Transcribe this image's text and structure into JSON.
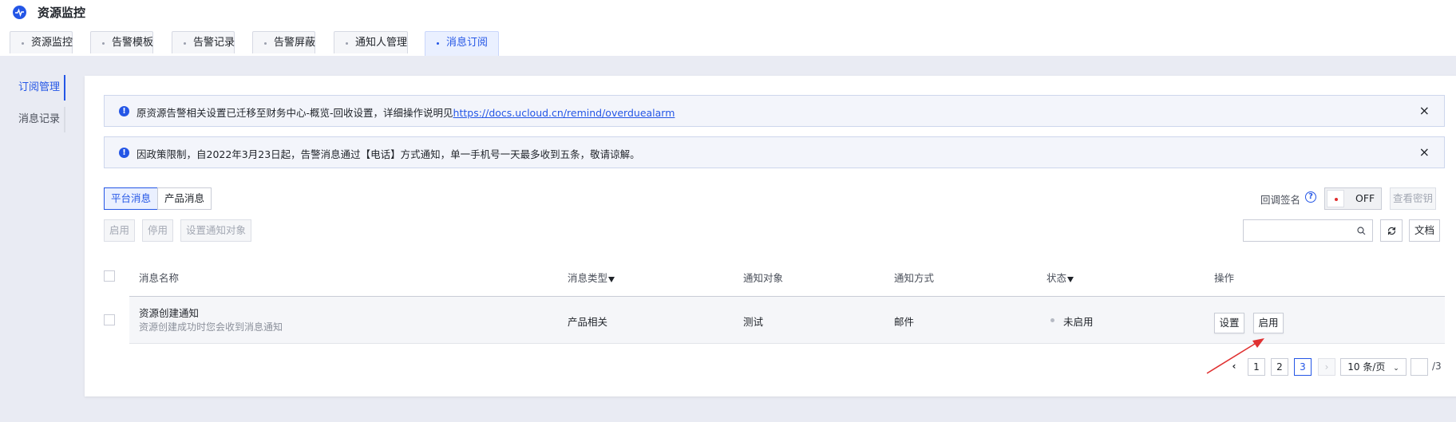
{
  "app": {
    "title": "资源监控",
    "logo_icon": "pulse-icon"
  },
  "tabs": [
    {
      "label": "资源监控"
    },
    {
      "label": "告警模板"
    },
    {
      "label": "告警记录"
    },
    {
      "label": "告警屏蔽"
    },
    {
      "label": "通知人管理"
    },
    {
      "label": "消息订阅"
    }
  ],
  "active_tab": "消息订阅",
  "sidebar": {
    "items": [
      {
        "label": "订阅管理"
      },
      {
        "label": "消息记录"
      }
    ]
  },
  "notices": [
    {
      "text": "原资源告警相关设置已迁移至财务中心-概览-回收设置，详细操作说明见",
      "link": "https://docs.ucloud.cn/remind/overduealarm",
      "close": "×"
    },
    {
      "text": "因政策限制，自2022年3月23日起，告警消息通过【电话】方式通知，单一手机号一天最多收到五条，敬请谅解。",
      "close": "×"
    }
  ],
  "segments": {
    "platform": "平台消息",
    "product": "产品消息"
  },
  "actions": {
    "enable": "启用",
    "disable": "停用",
    "set_target": "设置通知对象"
  },
  "callback": {
    "label": "回调签名",
    "toggle": "OFF",
    "view_key": "查看密钥"
  },
  "search": {
    "placeholder": ""
  },
  "toolbar": {
    "docs": "文档"
  },
  "table": {
    "columns": {
      "name": "消息名称",
      "type": "消息类型",
      "target": "通知对象",
      "method": "通知方式",
      "status": "状态",
      "ops": "操作"
    },
    "rows": [
      {
        "name": "资源创建通知",
        "desc": "资源创建成功时您会收到消息通知",
        "type": "产品相关",
        "target": "测试",
        "method": "邮件",
        "status": "未启用",
        "op_settings": "设置",
        "op_enable": "启用"
      }
    ]
  },
  "pagination": {
    "pages": [
      "1",
      "2",
      "3"
    ],
    "current": "3",
    "page_size": "10 条/页",
    "jump_value": "",
    "total": "/3"
  },
  "colors": {
    "accent": "#2456e6",
    "annotation_arrow": "#e03131"
  }
}
